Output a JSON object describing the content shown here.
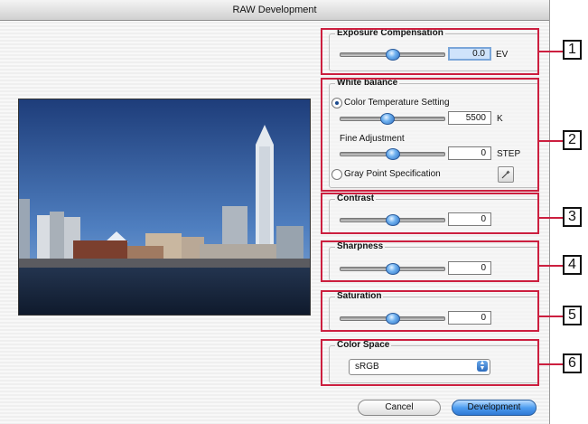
{
  "window": {
    "title": "RAW Development"
  },
  "exposure": {
    "title": "Exposure Compensation",
    "value": "0.0",
    "unit": "EV",
    "slider": 0.5
  },
  "white_balance": {
    "title": "White balance",
    "color_temp_label": "Color Temperature Setting",
    "color_temp_value": "5500",
    "color_temp_unit": "K",
    "color_temp_slider": 0.5,
    "fine_label": "Fine Adjustment",
    "fine_value": "0",
    "fine_unit": "STEP",
    "fine_slider": 0.5,
    "gray_point_label": "Gray Point Specification",
    "picker_icon": "eyedropper-icon"
  },
  "contrast": {
    "title": "Contrast",
    "value": "0",
    "slider": 0.5
  },
  "sharpness": {
    "title": "Sharpness",
    "value": "0",
    "slider": 0.5
  },
  "saturation": {
    "title": "Saturation",
    "value": "0",
    "slider": 0.5
  },
  "color_space": {
    "title": "Color Space",
    "selected": "sRGB"
  },
  "buttons": {
    "cancel": "Cancel",
    "develop": "Development"
  },
  "callouts": [
    "1",
    "2",
    "3",
    "4",
    "5",
    "6"
  ],
  "colors": {
    "callout_red": "#cc1f3f",
    "knob_blue": "#4f9ef0"
  }
}
